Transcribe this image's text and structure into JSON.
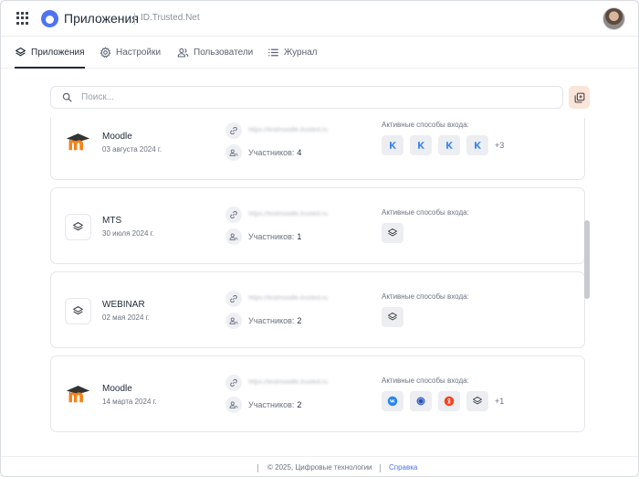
{
  "header": {
    "title": "Приложения",
    "subtitle": "ID.Trusted.Net"
  },
  "tabs": [
    {
      "label": "Приложения",
      "icon": "layers-icon",
      "active": true
    },
    {
      "label": "Настройки",
      "icon": "gear-icon",
      "active": false
    },
    {
      "label": "Пользователи",
      "icon": "users-icon",
      "active": false
    },
    {
      "label": "Журнал",
      "icon": "list-icon",
      "active": false
    }
  ],
  "search": {
    "placeholder": "Поиск..."
  },
  "apps": [
    {
      "name": "Moodle",
      "date": "03 августа 2024 г.",
      "icon": "moodle-logo",
      "url": "https://testmoodle.trusted.ru",
      "participants_label": "Участников:",
      "participants": "4",
      "methods_label": "Активные способы входа:",
      "methods": [
        "k-icon",
        "k-icon",
        "k-icon",
        "k-icon"
      ],
      "more": "+3"
    },
    {
      "name": "MTS",
      "date": "30 июля 2024 г.",
      "icon": "layers-icon",
      "url": "https://testmoodle.trusted.ru",
      "participants_label": "Участников:",
      "participants": "1",
      "methods_label": "Активные способы входа:",
      "methods": [
        "layers-icon"
      ],
      "more": ""
    },
    {
      "name": "WEBINAR",
      "date": "02 мая 2024 г.",
      "icon": "layers-icon",
      "url": "https://testmoodle.trusted.ru",
      "participants_label": "Участников:",
      "participants": "2",
      "methods_label": "Активные способы входа:",
      "methods": [
        "layers-icon"
      ],
      "more": ""
    },
    {
      "name": "Moodle",
      "date": "14 марта 2024 г.",
      "icon": "moodle-logo",
      "url": "https://testmoodle.trusted.ru",
      "participants_label": "Участников:",
      "participants": "2",
      "methods_label": "Активные способы входа:",
      "methods": [
        "vk-icon",
        "circle-icon",
        "yandex-icon",
        "layers-icon"
      ],
      "more": "+1"
    }
  ],
  "footer": {
    "copyright": "© 2025, Цифровые технологии",
    "help": "Справка"
  },
  "colors": {
    "accent": "#4f74f0",
    "vk": "#2787f5",
    "yandex": "#fc3f1d",
    "k_blue": "#3d8bf2",
    "moodle_orange": "#f98012"
  }
}
